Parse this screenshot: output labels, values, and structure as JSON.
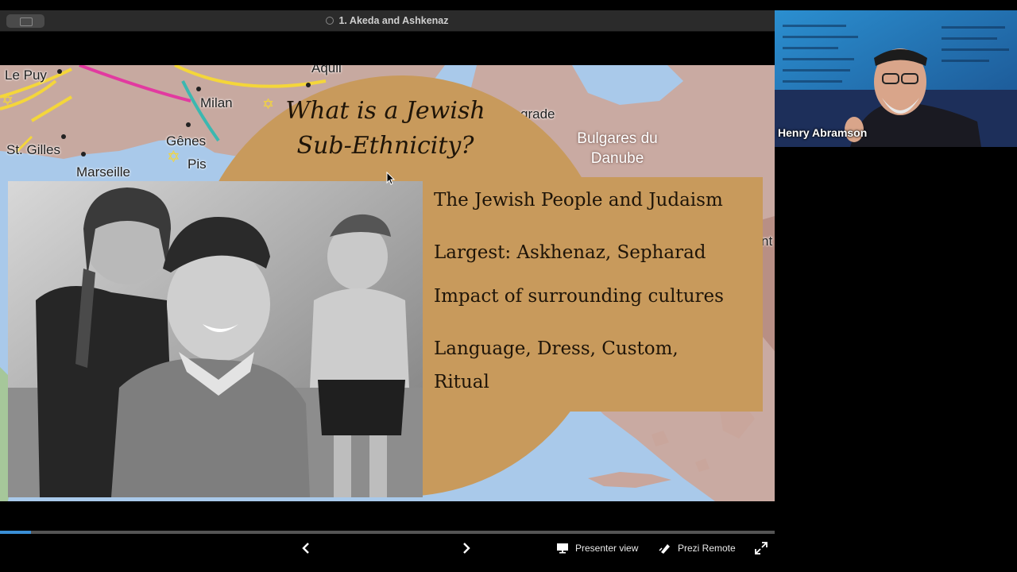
{
  "window": {
    "title": "1. Akeda and Ashkenaz"
  },
  "slide": {
    "title": "What is a Jewish Sub-Ethnicity?",
    "title_lines": [
      "What is a Jewish",
      "Sub-Ethnicity?"
    ],
    "bullets": [
      "The Jewish People and Judaism",
      "Largest: Askhenaz, Sepharad",
      "Impact of surrounding cultures",
      "Language, Dress, Custom,",
      "Ritual"
    ],
    "map_labels": {
      "le_puy": "Le Puy",
      "milan": "Milan",
      "genes": "Gênes",
      "pise": "Pis",
      "st_gilles": "St. Gilles",
      "marseille": "Marseille",
      "aquileia": "Aquil",
      "grade": "grade",
      "bulgares": "Bulgares du",
      "danube": "Danube",
      "right_edge": "nt"
    },
    "colors": {
      "accent_brown": "#c89a5c",
      "sea": "#a9c9ea",
      "land": "#c7a9a0"
    }
  },
  "progress": {
    "fraction": 0.04
  },
  "controls": {
    "prev_icon": "chevron-left-icon",
    "next_icon": "chevron-right-icon",
    "presenter_view_label": "Presenter view",
    "prezi_remote_label": "Prezi Remote",
    "fullscreen_icon": "expand-icon"
  },
  "video": {
    "participant_name": "Henry Abramson"
  }
}
